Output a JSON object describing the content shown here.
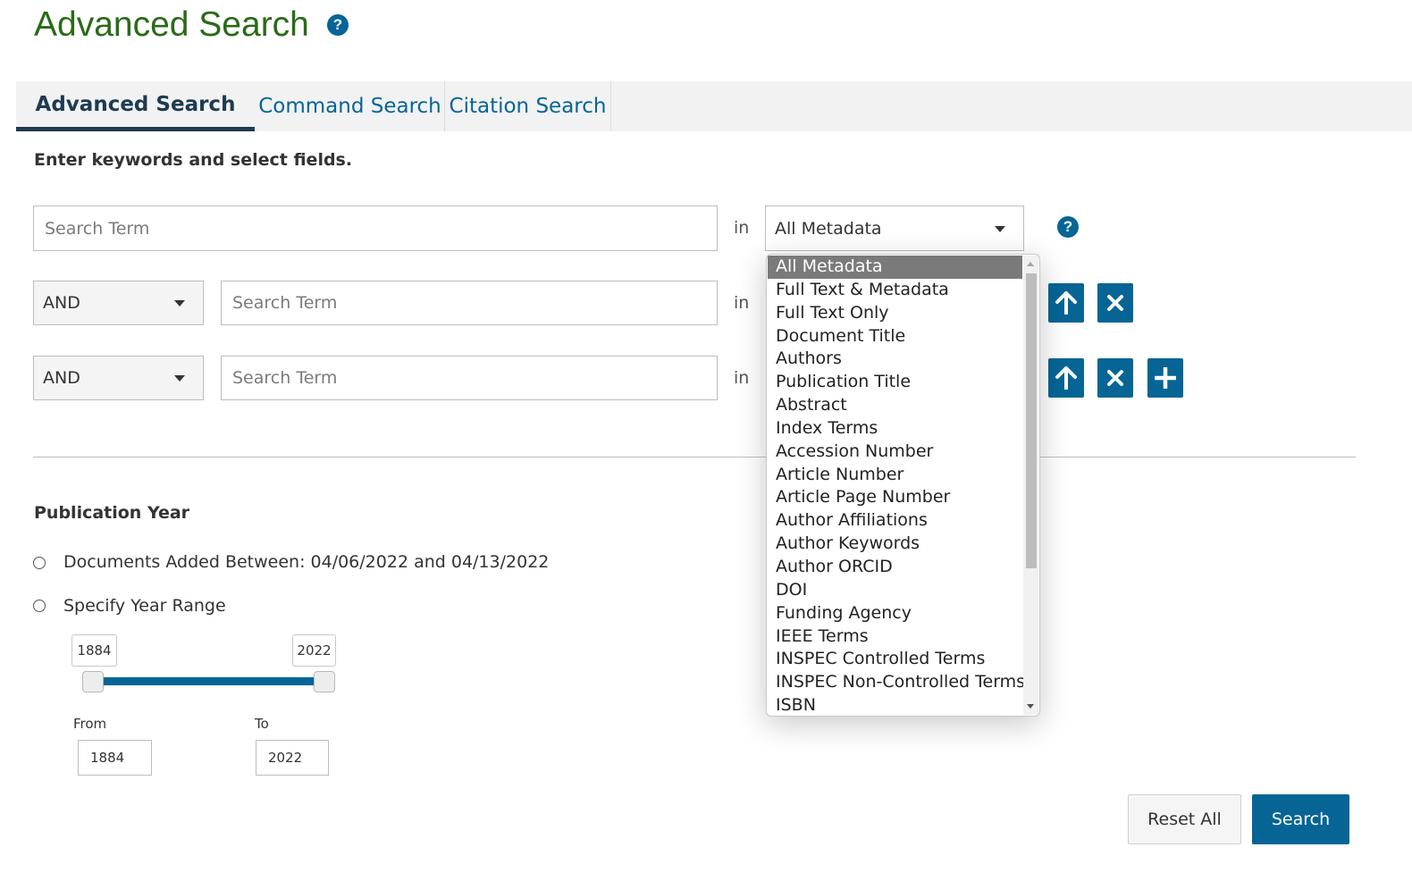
{
  "page": {
    "title": "Advanced Search",
    "help_icon": "question-circle-icon"
  },
  "tabs": [
    {
      "label": "Advanced Search",
      "active": true
    },
    {
      "label": "Command Search",
      "active": false
    },
    {
      "label": "Citation Search",
      "active": false
    }
  ],
  "instructions": "Enter keywords and select fields.",
  "search_rows": [
    {
      "operator": null,
      "placeholder": "Search Term",
      "in_label": "in",
      "field": "All Metadata"
    },
    {
      "operator": "AND",
      "placeholder": "Search Term",
      "in_label": "in"
    },
    {
      "operator": "AND",
      "placeholder": "Search Term",
      "in_label": "in"
    }
  ],
  "row_buttons": {
    "move_up_icon": "arrow-up-icon",
    "remove_icon": "close-icon",
    "add_icon": "plus-icon"
  },
  "field_dropdown": {
    "selected": "All Metadata",
    "options": [
      "All Metadata",
      "Full Text & Metadata",
      "Full Text Only",
      "Document Title",
      "Authors",
      "Publication Title",
      "Abstract",
      "Index Terms",
      "Accession Number",
      "Article Number",
      "Article Page Number",
      "Author Affiliations",
      "Author Keywords",
      "Author ORCID",
      "DOI",
      "Funding Agency",
      "IEEE Terms",
      "INSPEC Controlled Terms",
      "INSPEC Non-Controlled Terms",
      "ISBN"
    ]
  },
  "publication_year": {
    "title": "Publication Year",
    "option_added_between": "Documents Added Between: 04/06/2022 and 04/13/2022",
    "option_year_range": "Specify Year Range",
    "slider_min": "1884",
    "slider_max": "2022",
    "from_label": "From",
    "to_label": "To",
    "from_value": "1884",
    "to_value": "2022"
  },
  "actions": {
    "reset_label": "Reset All",
    "search_label": "Search"
  },
  "colors": {
    "primary": "#066595",
    "title_green": "#2a6a19",
    "active_tab": "#1d3b50"
  }
}
